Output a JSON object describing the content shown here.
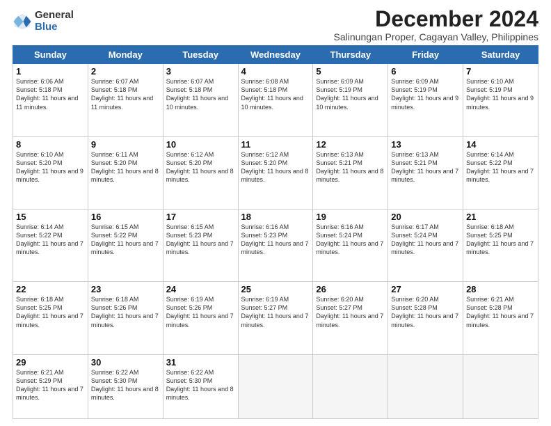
{
  "logo": {
    "general": "General",
    "blue": "Blue"
  },
  "title": "December 2024",
  "subtitle": "Salinungan Proper, Cagayan Valley, Philippines",
  "headers": [
    "Sunday",
    "Monday",
    "Tuesday",
    "Wednesday",
    "Thursday",
    "Friday",
    "Saturday"
  ],
  "weeks": [
    [
      {
        "day": "1",
        "sunrise": "6:06 AM",
        "sunset": "5:18 PM",
        "daylight": "11 hours and 11 minutes."
      },
      {
        "day": "2",
        "sunrise": "6:07 AM",
        "sunset": "5:18 PM",
        "daylight": "11 hours and 11 minutes."
      },
      {
        "day": "3",
        "sunrise": "6:07 AM",
        "sunset": "5:18 PM",
        "daylight": "11 hours and 10 minutes."
      },
      {
        "day": "4",
        "sunrise": "6:08 AM",
        "sunset": "5:18 PM",
        "daylight": "11 hours and 10 minutes."
      },
      {
        "day": "5",
        "sunrise": "6:09 AM",
        "sunset": "5:19 PM",
        "daylight": "11 hours and 10 minutes."
      },
      {
        "day": "6",
        "sunrise": "6:09 AM",
        "sunset": "5:19 PM",
        "daylight": "11 hours and 9 minutes."
      },
      {
        "day": "7",
        "sunrise": "6:10 AM",
        "sunset": "5:19 PM",
        "daylight": "11 hours and 9 minutes."
      }
    ],
    [
      {
        "day": "8",
        "sunrise": "6:10 AM",
        "sunset": "5:20 PM",
        "daylight": "11 hours and 9 minutes."
      },
      {
        "day": "9",
        "sunrise": "6:11 AM",
        "sunset": "5:20 PM",
        "daylight": "11 hours and 8 minutes."
      },
      {
        "day": "10",
        "sunrise": "6:12 AM",
        "sunset": "5:20 PM",
        "daylight": "11 hours and 8 minutes."
      },
      {
        "day": "11",
        "sunrise": "6:12 AM",
        "sunset": "5:20 PM",
        "daylight": "11 hours and 8 minutes."
      },
      {
        "day": "12",
        "sunrise": "6:13 AM",
        "sunset": "5:21 PM",
        "daylight": "11 hours and 8 minutes."
      },
      {
        "day": "13",
        "sunrise": "6:13 AM",
        "sunset": "5:21 PM",
        "daylight": "11 hours and 7 minutes."
      },
      {
        "day": "14",
        "sunrise": "6:14 AM",
        "sunset": "5:22 PM",
        "daylight": "11 hours and 7 minutes."
      }
    ],
    [
      {
        "day": "15",
        "sunrise": "6:14 AM",
        "sunset": "5:22 PM",
        "daylight": "11 hours and 7 minutes."
      },
      {
        "day": "16",
        "sunrise": "6:15 AM",
        "sunset": "5:22 PM",
        "daylight": "11 hours and 7 minutes."
      },
      {
        "day": "17",
        "sunrise": "6:15 AM",
        "sunset": "5:23 PM",
        "daylight": "11 hours and 7 minutes."
      },
      {
        "day": "18",
        "sunrise": "6:16 AM",
        "sunset": "5:23 PM",
        "daylight": "11 hours and 7 minutes."
      },
      {
        "day": "19",
        "sunrise": "6:16 AM",
        "sunset": "5:24 PM",
        "daylight": "11 hours and 7 minutes."
      },
      {
        "day": "20",
        "sunrise": "6:17 AM",
        "sunset": "5:24 PM",
        "daylight": "11 hours and 7 minutes."
      },
      {
        "day": "21",
        "sunrise": "6:18 AM",
        "sunset": "5:25 PM",
        "daylight": "11 hours and 7 minutes."
      }
    ],
    [
      {
        "day": "22",
        "sunrise": "6:18 AM",
        "sunset": "5:25 PM",
        "daylight": "11 hours and 7 minutes."
      },
      {
        "day": "23",
        "sunrise": "6:18 AM",
        "sunset": "5:26 PM",
        "daylight": "11 hours and 7 minutes."
      },
      {
        "day": "24",
        "sunrise": "6:19 AM",
        "sunset": "5:26 PM",
        "daylight": "11 hours and 7 minutes."
      },
      {
        "day": "25",
        "sunrise": "6:19 AM",
        "sunset": "5:27 PM",
        "daylight": "11 hours and 7 minutes."
      },
      {
        "day": "26",
        "sunrise": "6:20 AM",
        "sunset": "5:27 PM",
        "daylight": "11 hours and 7 minutes."
      },
      {
        "day": "27",
        "sunrise": "6:20 AM",
        "sunset": "5:28 PM",
        "daylight": "11 hours and 7 minutes."
      },
      {
        "day": "28",
        "sunrise": "6:21 AM",
        "sunset": "5:28 PM",
        "daylight": "11 hours and 7 minutes."
      }
    ],
    [
      {
        "day": "29",
        "sunrise": "6:21 AM",
        "sunset": "5:29 PM",
        "daylight": "11 hours and 7 minutes."
      },
      {
        "day": "30",
        "sunrise": "6:22 AM",
        "sunset": "5:30 PM",
        "daylight": "11 hours and 8 minutes."
      },
      {
        "day": "31",
        "sunrise": "6:22 AM",
        "sunset": "5:30 PM",
        "daylight": "11 hours and 8 minutes."
      },
      null,
      null,
      null,
      null
    ]
  ]
}
